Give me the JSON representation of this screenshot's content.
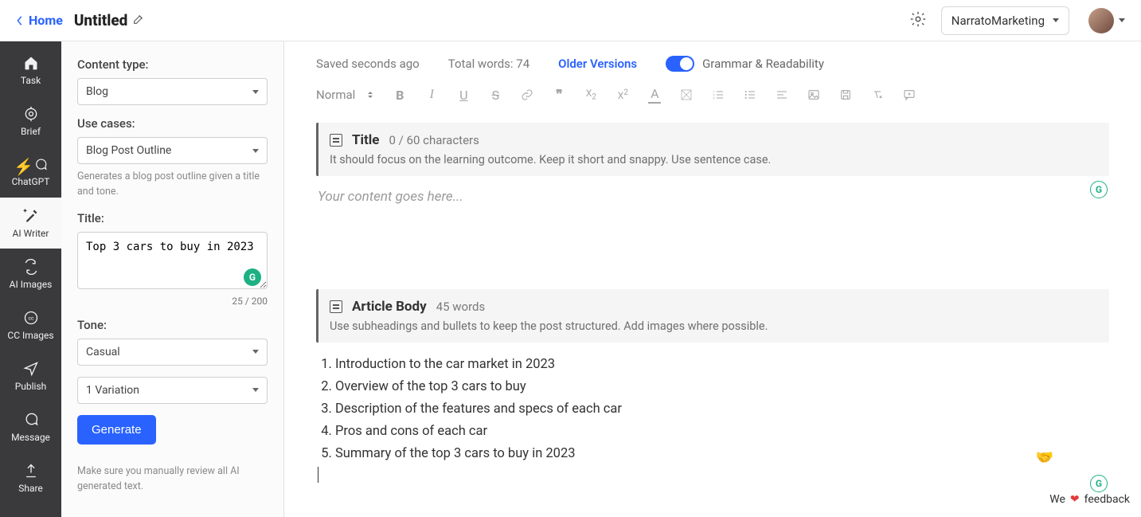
{
  "header": {
    "home_label": "Home",
    "doc_title": "Untitled",
    "workspace": "NarratoMarketing"
  },
  "rail": {
    "items": [
      {
        "label": "Task"
      },
      {
        "label": "Brief"
      },
      {
        "label": "ChatGPT"
      },
      {
        "label": "AI Writer"
      },
      {
        "label": "AI Images"
      },
      {
        "label": "CC Images"
      },
      {
        "label": "Publish"
      },
      {
        "label": "Message"
      },
      {
        "label": "Share"
      }
    ]
  },
  "left": {
    "content_type_label": "Content type:",
    "content_type_value": "Blog",
    "use_cases_label": "Use cases:",
    "use_cases_value": "Blog Post Outline",
    "use_cases_desc": "Generates a blog post outline given a title and tone.",
    "title_label": "Title:",
    "title_value": "Top 3 cars to buy in 2023",
    "title_count": "25 / 200",
    "tone_label": "Tone:",
    "tone_value": "Casual",
    "variations_value": "1 Variation",
    "generate_label": "Generate",
    "footnote": "Make sure you manually review all AI generated text."
  },
  "editor": {
    "saved_status": "Saved seconds ago",
    "total_words": "Total words: 74",
    "older_versions": "Older Versions",
    "grammar_label": "Grammar & Readability",
    "toolbar_normal": "Normal",
    "title_section": {
      "label": "Title",
      "meta": "0 / 60 characters",
      "hint": "It should focus on the learning outcome. Keep it short and snappy. Use sentence case.",
      "placeholder": "Your content goes here..."
    },
    "body_section": {
      "label": "Article Body",
      "meta": "45 words",
      "hint": "Use subheadings and bullets to keep the post structured. Add images where possible.",
      "items": [
        "Introduction to the car market in 2023",
        "Overview of the top 3 cars to buy",
        "Description of the features and specs of each car",
        "Pros and cons of each car",
        "Summary of the top 3 cars to buy in 2023"
      ]
    }
  },
  "feedback": {
    "pre": "We",
    "post": "feedback"
  }
}
